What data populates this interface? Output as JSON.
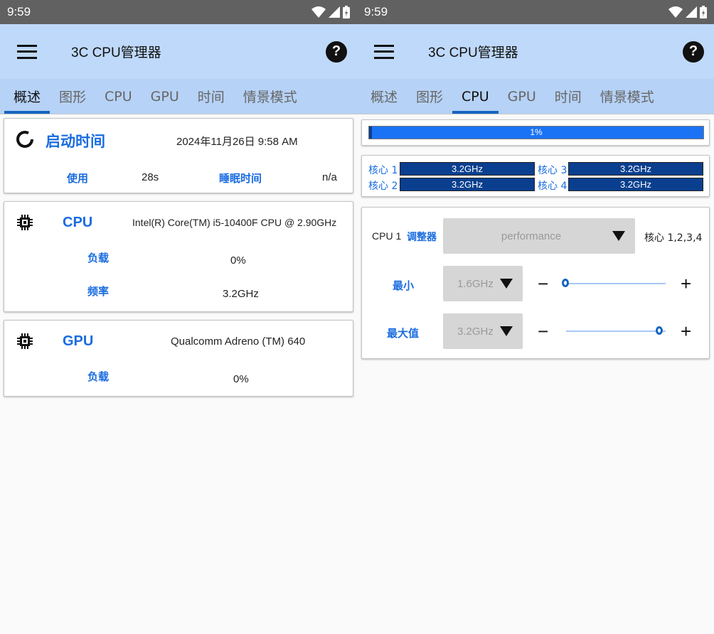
{
  "status": {
    "time": "9:59"
  },
  "app": {
    "title": "3C CPU管理器"
  },
  "tabs": [
    "概述",
    "图形",
    "CPU",
    "GPU",
    "时间",
    "情景模式"
  ],
  "overview": {
    "uptime": {
      "title": "启动时间",
      "date": "2024年11月26日 9:58 AM",
      "usage_label": "使用",
      "usage_value": "28s",
      "sleep_label": "睡眠时间",
      "sleep_value": "n/a"
    },
    "cpu": {
      "title": "CPU",
      "model": "Intel(R) Core(TM) i5-10400F CPU @ 2.90GHz",
      "load_label": "负载",
      "load_value": "0%",
      "freq_label": "频率",
      "freq_value": "3.2GHz"
    },
    "gpu": {
      "title": "GPU",
      "model": "Qualcomm Adreno (TM) 640",
      "load_label": "负载",
      "load_value": "0%"
    }
  },
  "cpu_tab": {
    "usage": {
      "label": "1%",
      "fraction": 0.01
    },
    "cores": [
      {
        "label": "核心 1",
        "freq": "3.2GHz"
      },
      {
        "label": "核心 2",
        "freq": "3.2GHz"
      },
      {
        "label": "核心 3",
        "freq": "3.2GHz"
      },
      {
        "label": "核心 4",
        "freq": "3.2GHz"
      }
    ],
    "governor": {
      "cpu_label": "CPU 1",
      "label": "调整器",
      "value": "performance",
      "cores": "核心 1,2,3,4"
    },
    "min": {
      "label": "最小",
      "value": "1.6GHz",
      "level": 0.0
    },
    "max": {
      "label": "最大值",
      "value": "3.2GHz",
      "level": 1.0
    },
    "plus": "+",
    "minus": "−"
  },
  "colors": {
    "accent": "#1a6ce0",
    "appbar": "#bfd9fb",
    "tabbar": "#b6d2f6",
    "core_bar": "#0a3f8f",
    "usage_bar": "#1a73f5"
  }
}
